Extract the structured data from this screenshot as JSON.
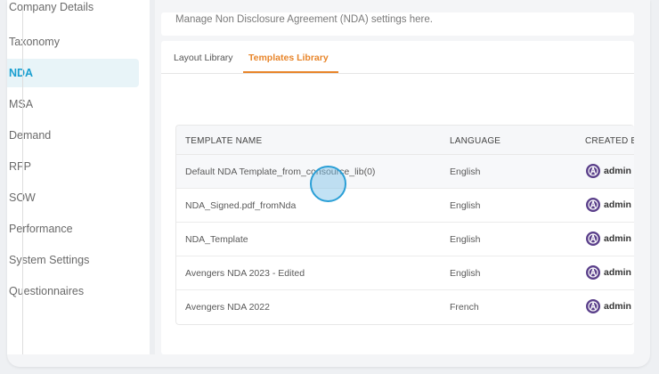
{
  "sidebar": {
    "items": [
      {
        "label": "Company Details",
        "active": false
      },
      {
        "label": "Taxonomy",
        "active": false
      },
      {
        "label": "NDA",
        "active": true
      },
      {
        "label": "MSA",
        "active": false
      },
      {
        "label": "Demand",
        "active": false
      },
      {
        "label": "RFP",
        "active": false
      },
      {
        "label": "SOW",
        "active": false
      },
      {
        "label": "Performance",
        "active": false
      },
      {
        "label": "System Settings",
        "active": false
      },
      {
        "label": "Questionnaires",
        "active": false
      }
    ]
  },
  "header": {
    "subtitle": "Manage Non Disclosure Agreement (NDA) settings here."
  },
  "tabs": [
    {
      "label": "Layout Library",
      "active": false
    },
    {
      "label": "Templates Library",
      "active": true
    }
  ],
  "table": {
    "columns": [
      "TEMPLATE NAME",
      "LANGUAGE",
      "CREATED BY"
    ],
    "rows": [
      {
        "name": "Default NDA Template_from_consource_lib(0)",
        "language": "English",
        "created_by": "admin"
      },
      {
        "name": "NDA_Signed.pdf_fromNda",
        "language": "English",
        "created_by": "admin"
      },
      {
        "name": "NDA_Template",
        "language": "English",
        "created_by": "admin"
      },
      {
        "name": "Avengers NDA 2023 - Edited",
        "language": "English",
        "created_by": "admin"
      },
      {
        "name": "Avengers NDA 2022",
        "language": "French",
        "created_by": "admin"
      }
    ]
  },
  "colors": {
    "accent_orange": "#e8852a",
    "active_blue": "#1a9fd0",
    "avatar_purple": "#5a3f8a"
  },
  "icons": {
    "avatar": "avengers-logo-icon"
  }
}
